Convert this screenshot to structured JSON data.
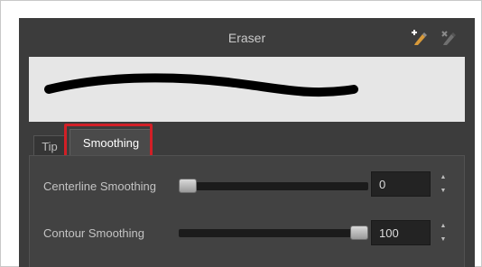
{
  "panel": {
    "title": "Eraser"
  },
  "icons": {
    "new_preset": "new-preset-icon",
    "delete_preset": "delete-preset-icon"
  },
  "tabs": [
    {
      "label": "Tip",
      "selected": false
    },
    {
      "label": "Smoothing",
      "selected": true
    }
  ],
  "sliders": [
    {
      "label": "Centerline Smoothing",
      "value": "0",
      "level": 0.0
    },
    {
      "label": "Contour Smoothing",
      "value": "100",
      "level": 1.0
    }
  ],
  "colors": {
    "panel_bg": "#3c3c3c",
    "highlight": "#d21f26",
    "preview_bg": "#e6e6e6"
  }
}
